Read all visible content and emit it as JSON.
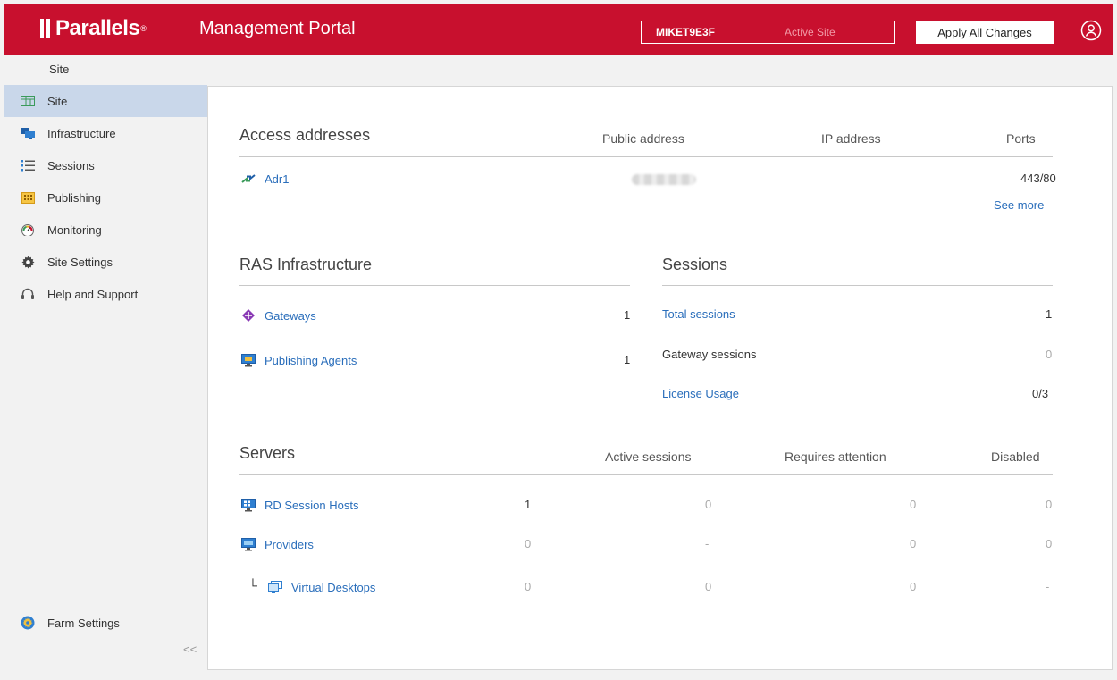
{
  "header": {
    "brand": "Parallels",
    "title": "Management Portal",
    "site_name": "MIKET9E3F",
    "site_status": "Active Site",
    "apply_label": "Apply All Changes"
  },
  "breadcrumb": "Site",
  "sidebar": {
    "items": [
      {
        "label": "Site",
        "icon": "site-grid-icon"
      },
      {
        "label": "Infrastructure",
        "icon": "monitors-icon"
      },
      {
        "label": "Sessions",
        "icon": "list-icon"
      },
      {
        "label": "Publishing",
        "icon": "publishing-grid-icon"
      },
      {
        "label": "Monitoring",
        "icon": "gauge-icon"
      },
      {
        "label": "Site Settings",
        "icon": "gear-icon"
      },
      {
        "label": "Help and Support",
        "icon": "headset-icon"
      }
    ],
    "farm_settings": "Farm Settings",
    "collapse": "<<"
  },
  "access": {
    "heading": "Access addresses",
    "col_public": "Public address",
    "col_ip": "IP address",
    "col_ports": "Ports",
    "row_name": "Adr1",
    "row_ports": "443/80",
    "see_more": "See more"
  },
  "infra": {
    "heading": "RAS Infrastructure",
    "gateways": "Gateways",
    "gateways_count": "1",
    "agents": "Publishing Agents",
    "agents_count": "1"
  },
  "sessions": {
    "heading": "Sessions",
    "total_label": "Total sessions",
    "total_value": "1",
    "gateway_label": "Gateway sessions",
    "gateway_value": "0",
    "license_label": "License Usage",
    "license_value": "0/3"
  },
  "servers": {
    "heading": "Servers",
    "col_active": "Active sessions",
    "col_attention": "Requires attention",
    "col_disabled": "Disabled",
    "rows": [
      {
        "name": "RD Session Hosts",
        "count": "1",
        "active": "0",
        "attention": "0",
        "disabled": "0"
      },
      {
        "name": "Providers",
        "count": "0",
        "active": "-",
        "attention": "0",
        "disabled": "0"
      },
      {
        "name": "Virtual Desktops",
        "count": "0",
        "active": "0",
        "attention": "0",
        "disabled": "-"
      }
    ]
  },
  "colors": {
    "brand_red": "#c8102e",
    "link_blue": "#2a6ebb",
    "active_nav": "#c9d7ea"
  }
}
